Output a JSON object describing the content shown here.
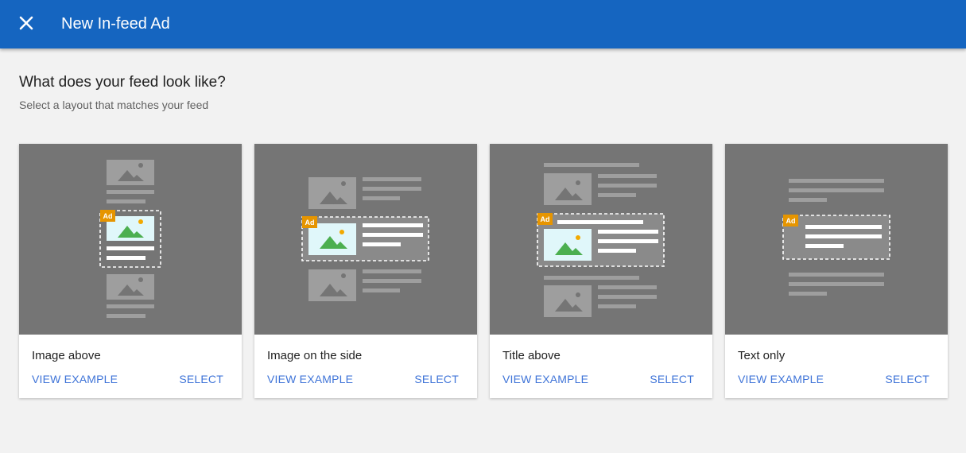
{
  "header": {
    "title": "New In-feed Ad",
    "close_icon": "close-icon",
    "background": "#1565c0"
  },
  "main": {
    "heading": "What does your feed look like?",
    "subheading": "Select a layout that matches your feed"
  },
  "ad_badge": "Ad",
  "cards": [
    {
      "title": "Image above",
      "view_label": "VIEW EXAMPLE",
      "select_label": "SELECT"
    },
    {
      "title": "Image on the side",
      "view_label": "VIEW EXAMPLE",
      "select_label": "SELECT"
    },
    {
      "title": "Title above",
      "view_label": "VIEW EXAMPLE",
      "select_label": "SELECT"
    },
    {
      "title": "Text only",
      "view_label": "VIEW EXAMPLE",
      "select_label": "SELECT"
    }
  ],
  "colors": {
    "accent": "#1565c0",
    "link": "#3f74d8",
    "ad_badge": "#e69500",
    "preview_bg": "#757575"
  }
}
